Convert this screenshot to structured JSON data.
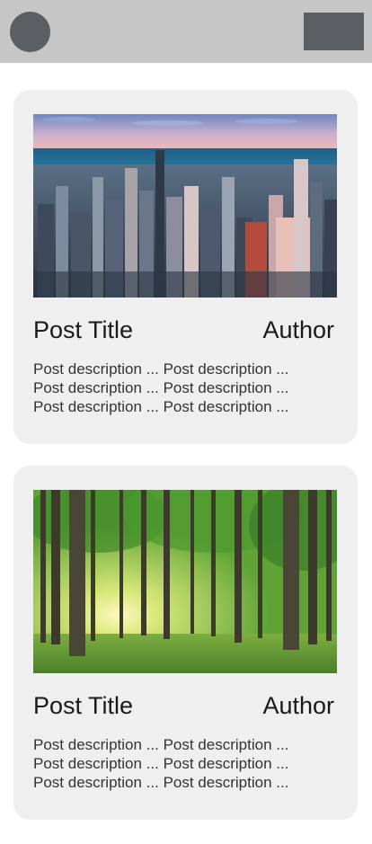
{
  "header": {
    "avatar_icon": "user-avatar-icon",
    "menu_icon": "menu-icon",
    "colors": {
      "bar": "#c6c6c6",
      "controls": "#5b5f62"
    }
  },
  "posts": [
    {
      "image": "city-skyline-photo",
      "title": "Post Title",
      "author": "Author",
      "description": [
        "Post description ... Post description ...",
        "Post description ... Post description ...",
        "Post description ... Post description ..."
      ]
    },
    {
      "image": "forest-sunlight-photo",
      "title": "Post Title",
      "author": "Author",
      "description": [
        "Post description ... Post description ...",
        "Post description ... Post description ...",
        "Post description ... Post description ..."
      ]
    }
  ]
}
